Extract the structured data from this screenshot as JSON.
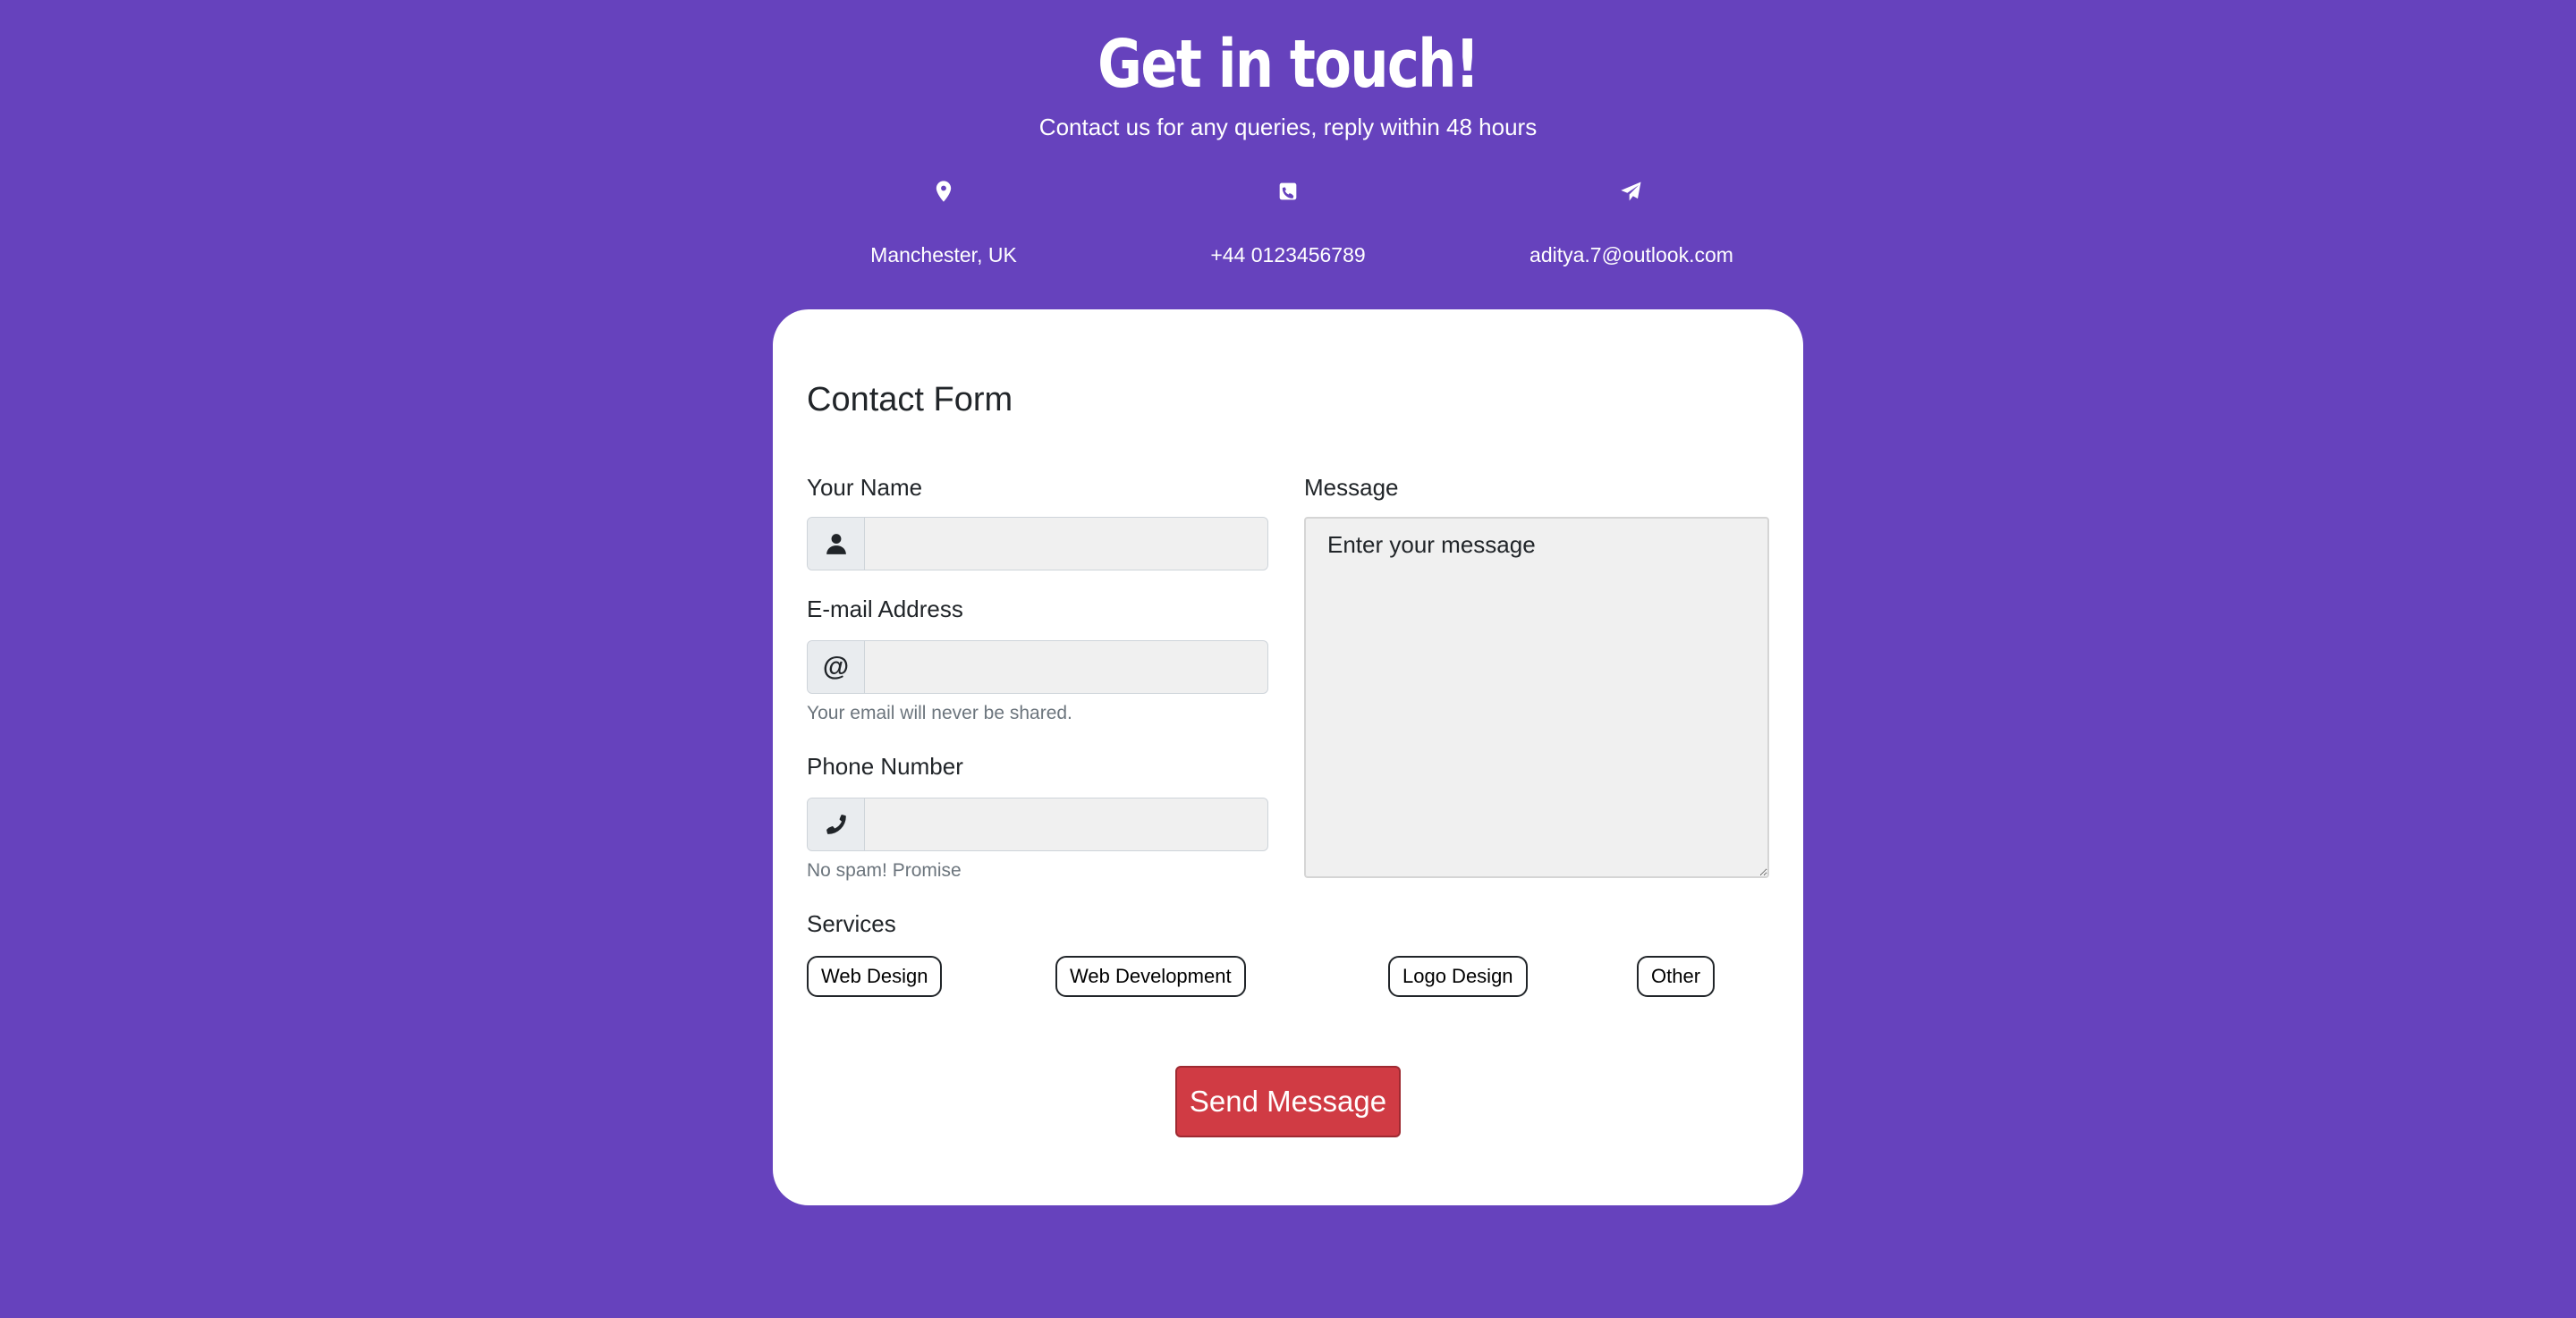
{
  "hero": {
    "title": "Get in touch!",
    "subtitle": "Contact us for any queries, reply within 48 hours"
  },
  "contact_info": [
    {
      "icon": "map-pin-icon",
      "text": "Manchester, UK"
    },
    {
      "icon": "phone-square-icon",
      "text": "+44 0123456789"
    },
    {
      "icon": "paper-plane-icon",
      "text": "aditya.7@outlook.com"
    }
  ],
  "form": {
    "title": "Contact Form",
    "name": {
      "label": "Your Name",
      "icon": "user-icon",
      "value": ""
    },
    "email": {
      "label": "E-mail Address",
      "icon_text": "@",
      "value": "",
      "help": "Your email will never be shared."
    },
    "phone": {
      "label": "Phone Number",
      "icon": "phone-icon",
      "value": "",
      "help": "No spam! Promise"
    },
    "message": {
      "label": "Message",
      "placeholder": "Enter your message"
    },
    "services": {
      "label": "Services",
      "options": [
        "Web Design",
        "Web Development",
        "Logo Design",
        "Other"
      ]
    },
    "submit_label": "Send Message"
  },
  "colors": {
    "background": "#6642bd",
    "card": "#ffffff",
    "submit": "#d03b44"
  }
}
